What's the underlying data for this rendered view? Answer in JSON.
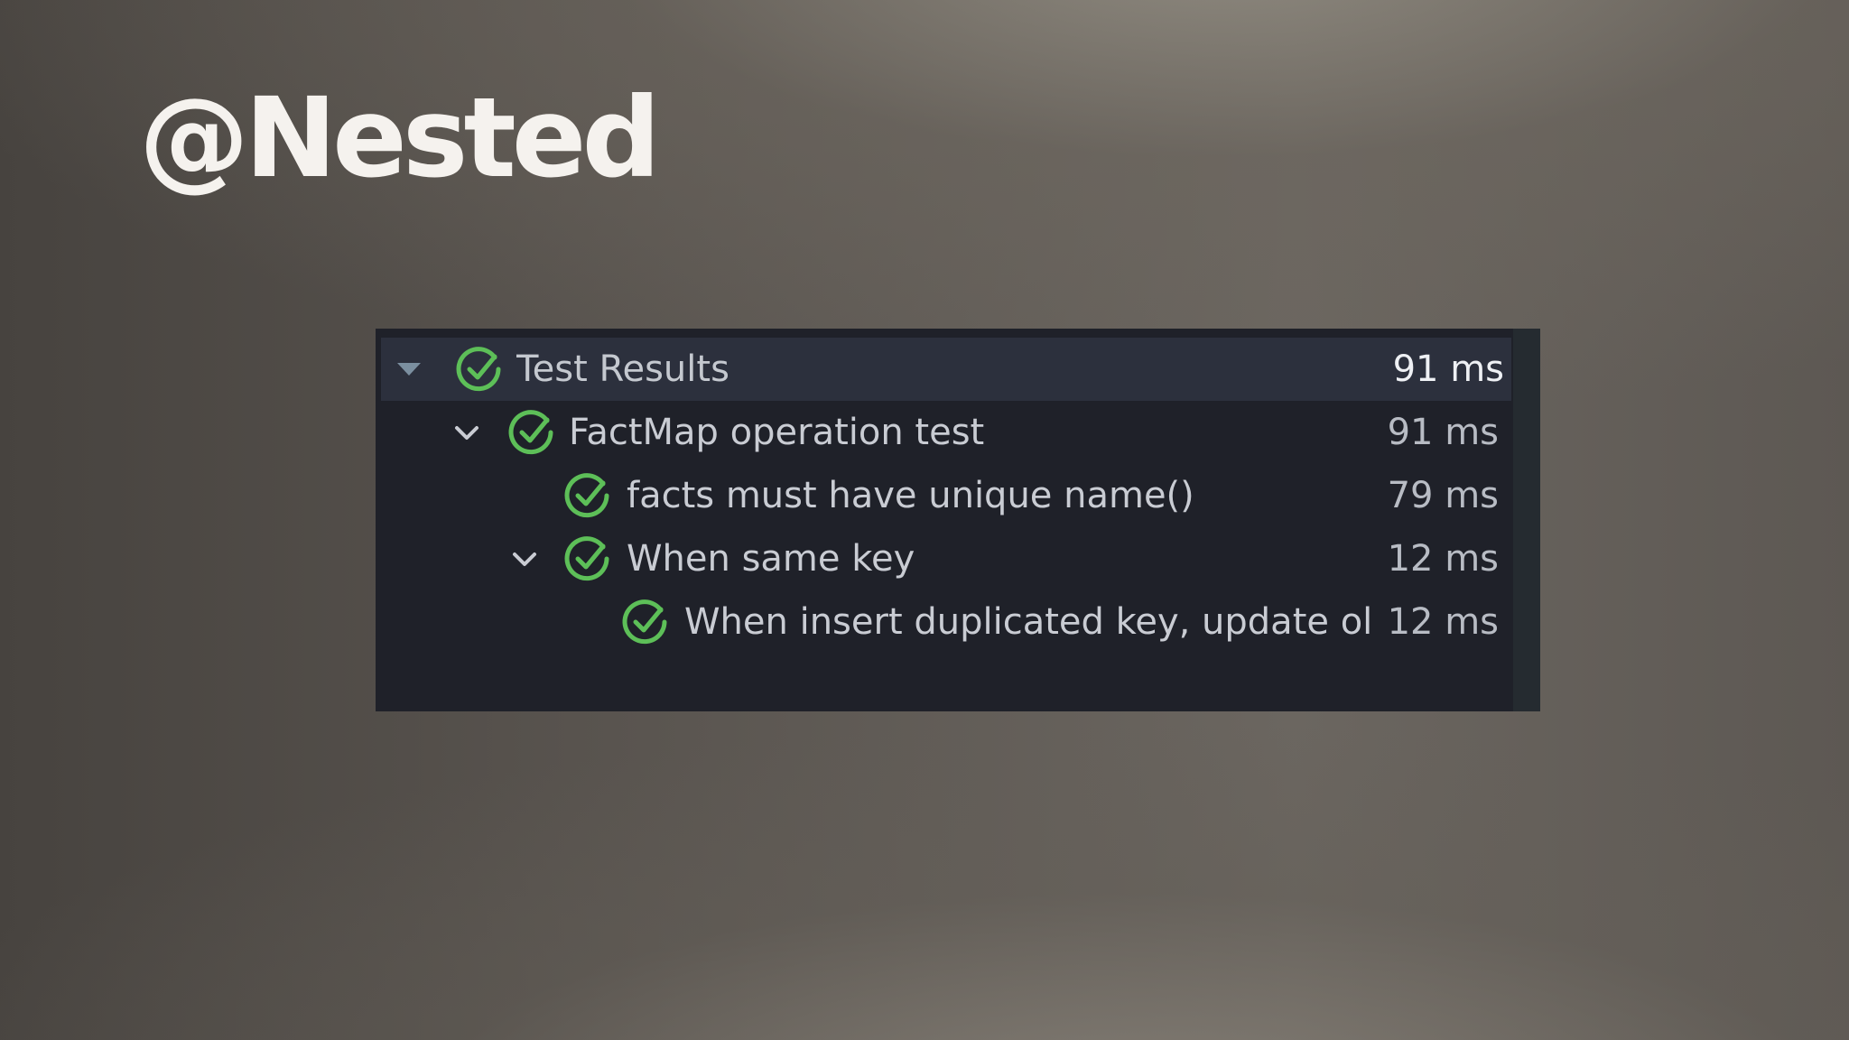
{
  "slide": {
    "title": "@Nested"
  },
  "test_results": {
    "rows": [
      {
        "label": "Test Results",
        "duration": "91 ms",
        "status": "passed",
        "expanded": true,
        "selected": true
      },
      {
        "label": "FactMap operation test",
        "duration": "91 ms",
        "status": "passed",
        "expanded": true
      },
      {
        "label": "facts must have unique name()",
        "duration": "79 ms",
        "status": "passed"
      },
      {
        "label": "When same key",
        "duration": "12 ms",
        "status": "passed",
        "expanded": true
      },
      {
        "label": "When insert duplicated key, update olc",
        "duration": "12 ms",
        "status": "passed"
      }
    ]
  },
  "colors": {
    "pass_green": "#5dbf58",
    "panel_background": "#1f2129",
    "selected_row": "#2c303d"
  },
  "icons": {
    "expanded": "chevron-down-icon",
    "passed": "check-circle-icon"
  }
}
